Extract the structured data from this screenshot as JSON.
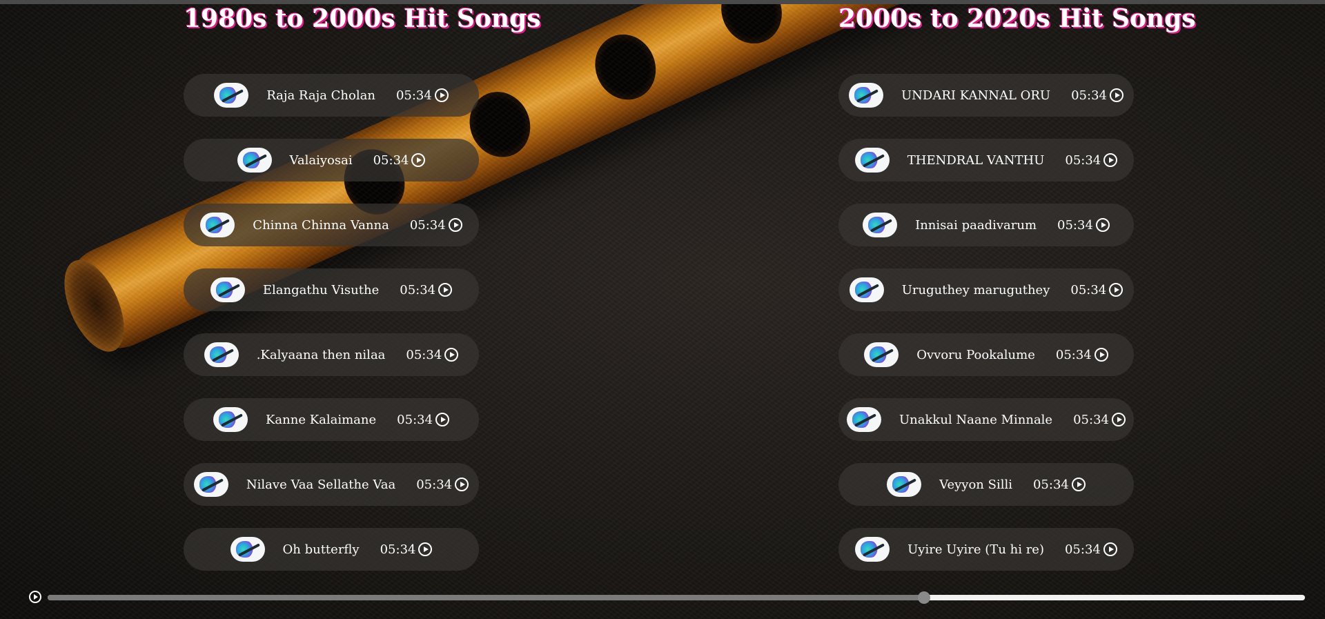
{
  "page": {
    "accent_color": "#e11d8c",
    "title_color": "#ffffff"
  },
  "left_column": {
    "title": "1980s to 2000s Hit Songs",
    "songs": [
      {
        "title": "Raja Raja Cholan",
        "duration": "05:34"
      },
      {
        "title": "Valaiyosai",
        "duration": "05:34"
      },
      {
        "title": "Chinna Chinna Vanna",
        "duration": "05:34"
      },
      {
        "title": "Elangathu Visuthe",
        "duration": "05:34"
      },
      {
        "title": ".Kalyaana then nilaa",
        "duration": "05:34"
      },
      {
        "title": "Kanne Kalaimane",
        "duration": "05:34"
      },
      {
        "title": "Nilave Vaa Sellathe Vaa",
        "duration": "05:34"
      },
      {
        "title": "Oh butterfly",
        "duration": "05:34"
      }
    ]
  },
  "right_column": {
    "title": "2000s to 2020s Hit Songs",
    "songs": [
      {
        "title": "UNDARI KANNAL ORU",
        "duration": "05:34"
      },
      {
        "title": "THENDRAL VANTHU",
        "duration": "05:34"
      },
      {
        "title": "Innisai paadivarum",
        "duration": "05:34"
      },
      {
        "title": "Uruguthey maruguthey",
        "duration": "05:34"
      },
      {
        "title": "Ovvoru Pookalume",
        "duration": "05:34"
      },
      {
        "title": "Unakkul Naane Minnale",
        "duration": "05:34"
      },
      {
        "title": "Veyyon Silli",
        "duration": "05:34"
      },
      {
        "title": "Uyire Uyire (Tu hi re)",
        "duration": "05:34"
      }
    ]
  },
  "player": {
    "progress": 0.697,
    "icon": "play-icon"
  }
}
